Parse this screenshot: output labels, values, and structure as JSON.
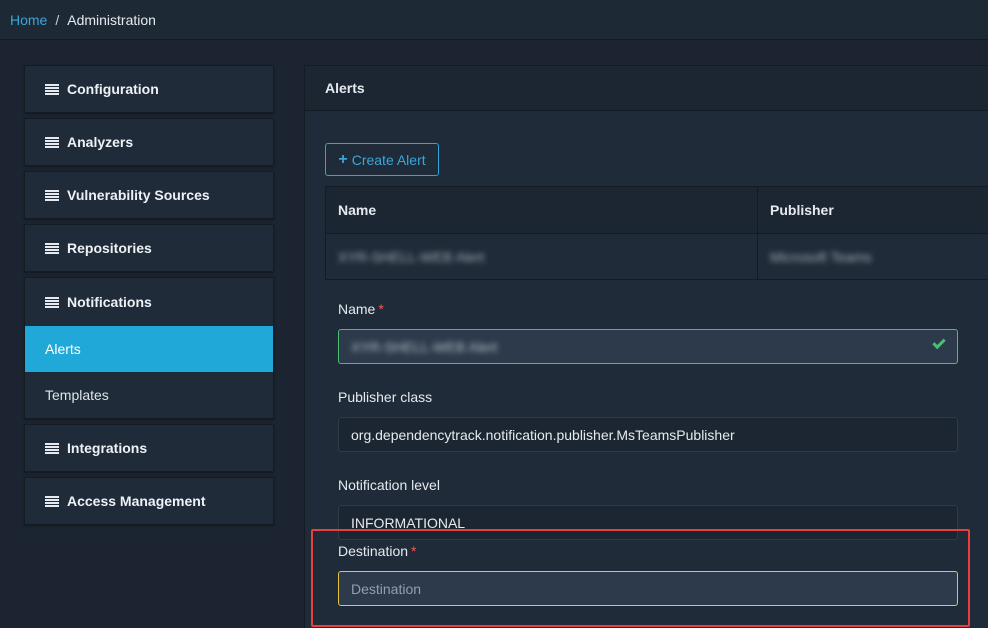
{
  "breadcrumb": {
    "home": "Home",
    "separator": "/",
    "current": "Administration"
  },
  "sidebar": {
    "items": [
      {
        "label": "Configuration"
      },
      {
        "label": "Analyzers"
      },
      {
        "label": "Vulnerability Sources"
      },
      {
        "label": "Repositories"
      }
    ],
    "notifications": {
      "label": "Notifications",
      "subitems": [
        {
          "label": "Alerts"
        },
        {
          "label": "Templates"
        }
      ]
    },
    "items_after": [
      {
        "label": "Integrations"
      },
      {
        "label": "Access Management"
      }
    ]
  },
  "panel": {
    "title": "Alerts",
    "create_button": "Create Alert",
    "table": {
      "headers": [
        "Name",
        "Publisher"
      ],
      "rows": [
        {
          "name": "XYR-SHELL-WEB Alert",
          "publisher": "Microsoft Teams"
        }
      ]
    },
    "form": {
      "name_label": "Name",
      "required_mark": "*",
      "name_value": "XYR-SHELL-WEB Alert",
      "publisher_label": "Publisher class",
      "publisher_value": "org.dependencytrack.notification.publisher.MsTeamsPublisher",
      "level_label": "Notification level",
      "level_value": "INFORMATIONAL",
      "destination_label": "Destination",
      "destination_placeholder": "Destination"
    }
  },
  "colors": {
    "accent": "#20a8d8",
    "valid": "#4dbd74",
    "focus": "#e4c441",
    "highlight": "#e8403c",
    "required": "#f25a5a"
  }
}
